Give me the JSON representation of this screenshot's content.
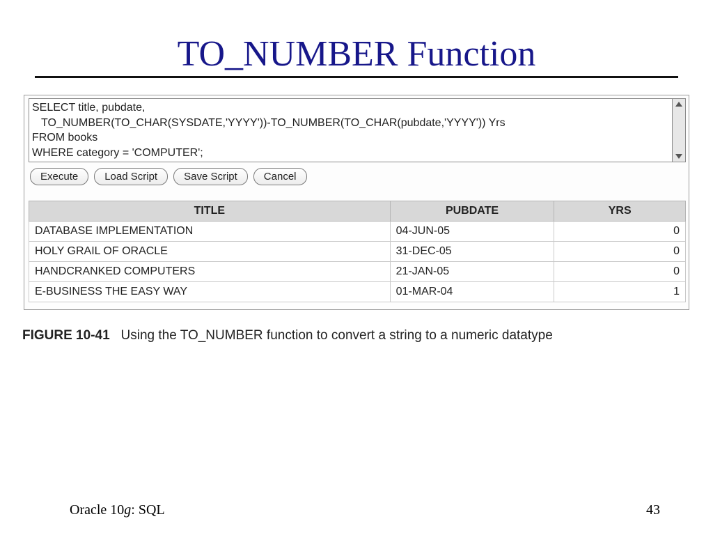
{
  "title": "TO_NUMBER Function",
  "sql_lines": [
    "SELECT title, pubdate,",
    "   TO_NUMBER(TO_CHAR(SYSDATE,'YYYY'))-TO_NUMBER(TO_CHAR(pubdate,'YYYY')) Yrs",
    "FROM books",
    "WHERE category = 'COMPUTER';"
  ],
  "buttons": {
    "execute": "Execute",
    "load": "Load Script",
    "save": "Save Script",
    "cancel": "Cancel"
  },
  "table": {
    "headers": {
      "title": "TITLE",
      "pubdate": "PUBDATE",
      "yrs": "YRS"
    },
    "rows": [
      {
        "title": "DATABASE IMPLEMENTATION",
        "pubdate": "04-JUN-05",
        "yrs": "0"
      },
      {
        "title": "HOLY GRAIL OF ORACLE",
        "pubdate": "31-DEC-05",
        "yrs": "0"
      },
      {
        "title": "HANDCRANKED COMPUTERS",
        "pubdate": "21-JAN-05",
        "yrs": "0"
      },
      {
        "title": "E-BUSINESS THE EASY WAY",
        "pubdate": "01-MAR-04",
        "yrs": "1"
      }
    ]
  },
  "caption": {
    "label": "FIGURE 10-41",
    "text": "Using the TO_NUMBER function to convert a string to a numeric datatype"
  },
  "footer": {
    "product_pre": "Oracle 10",
    "product_g": "g",
    "product_post": ": SQL",
    "page": "43"
  }
}
